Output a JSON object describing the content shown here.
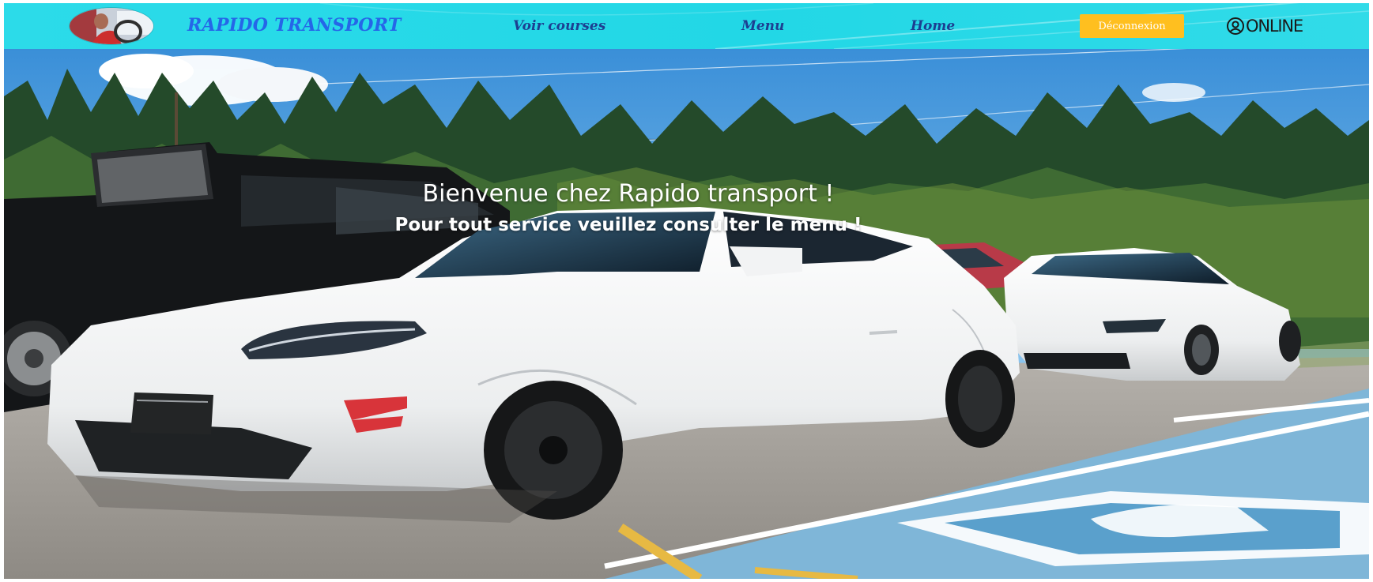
{
  "navbar": {
    "brand": "RAPIDO TRANSPORT",
    "links": [
      {
        "label": "Voir courses"
      },
      {
        "label": "Menu"
      },
      {
        "label": "Home"
      }
    ],
    "logout_label": "Déconnexion",
    "status_label": "ONLINE",
    "status_icon": "user-circle-icon",
    "logo_icon": "driver-photo",
    "colors": {
      "bar": "#2cdbe9",
      "brand": "#2566e8",
      "links": "#1d3f91",
      "logout_button": "#ffbf1f"
    }
  },
  "hero": {
    "title": "Bienvenue chez Rapido transport !",
    "subtitle": "Pour tout service veuillez consulter le menu !",
    "image": "white sports cars parked in a lot with pine forest and blue sky"
  }
}
